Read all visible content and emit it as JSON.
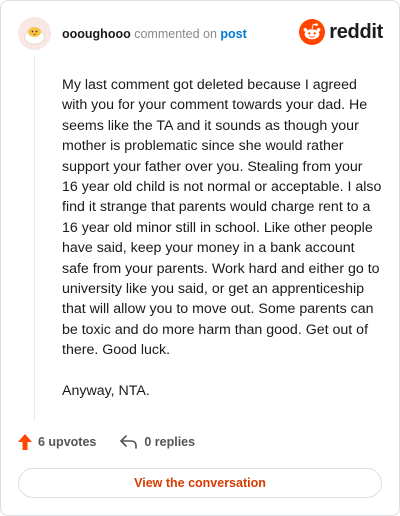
{
  "header": {
    "username": "oooughooo",
    "commented_on_text": "commented on",
    "post_link": "post",
    "brand": "reddit",
    "brand_color": "#ff4500"
  },
  "comment": {
    "paragraphs": [
      "My last comment got deleted because I agreed with you for your comment towards your dad. He seems like the TA and it sounds as though your mother is problematic since she would rather support your father over you. Stealing from your 16 year old child is not normal or acceptable. I also find it strange that parents would charge rent to a 16 year old minor still in school. Like other people have said, keep your money in a bank account safe from your parents. Work hard and either go to university like you said, or get an apprenticeship that will allow you to move out. Some parents can be toxic and do more harm than good. Get out of there. Good luck.",
      "Anyway, NTA."
    ]
  },
  "actions": {
    "upvotes_label": "6 upvotes",
    "replies_label": "0 replies",
    "upvote_icon": "upvote-arrow-icon",
    "reply_icon": "reply-arrow-icon",
    "upvote_color": "#ff4500"
  },
  "footer": {
    "view_button_label": "View the conversation",
    "button_text_color": "#d93a00"
  }
}
